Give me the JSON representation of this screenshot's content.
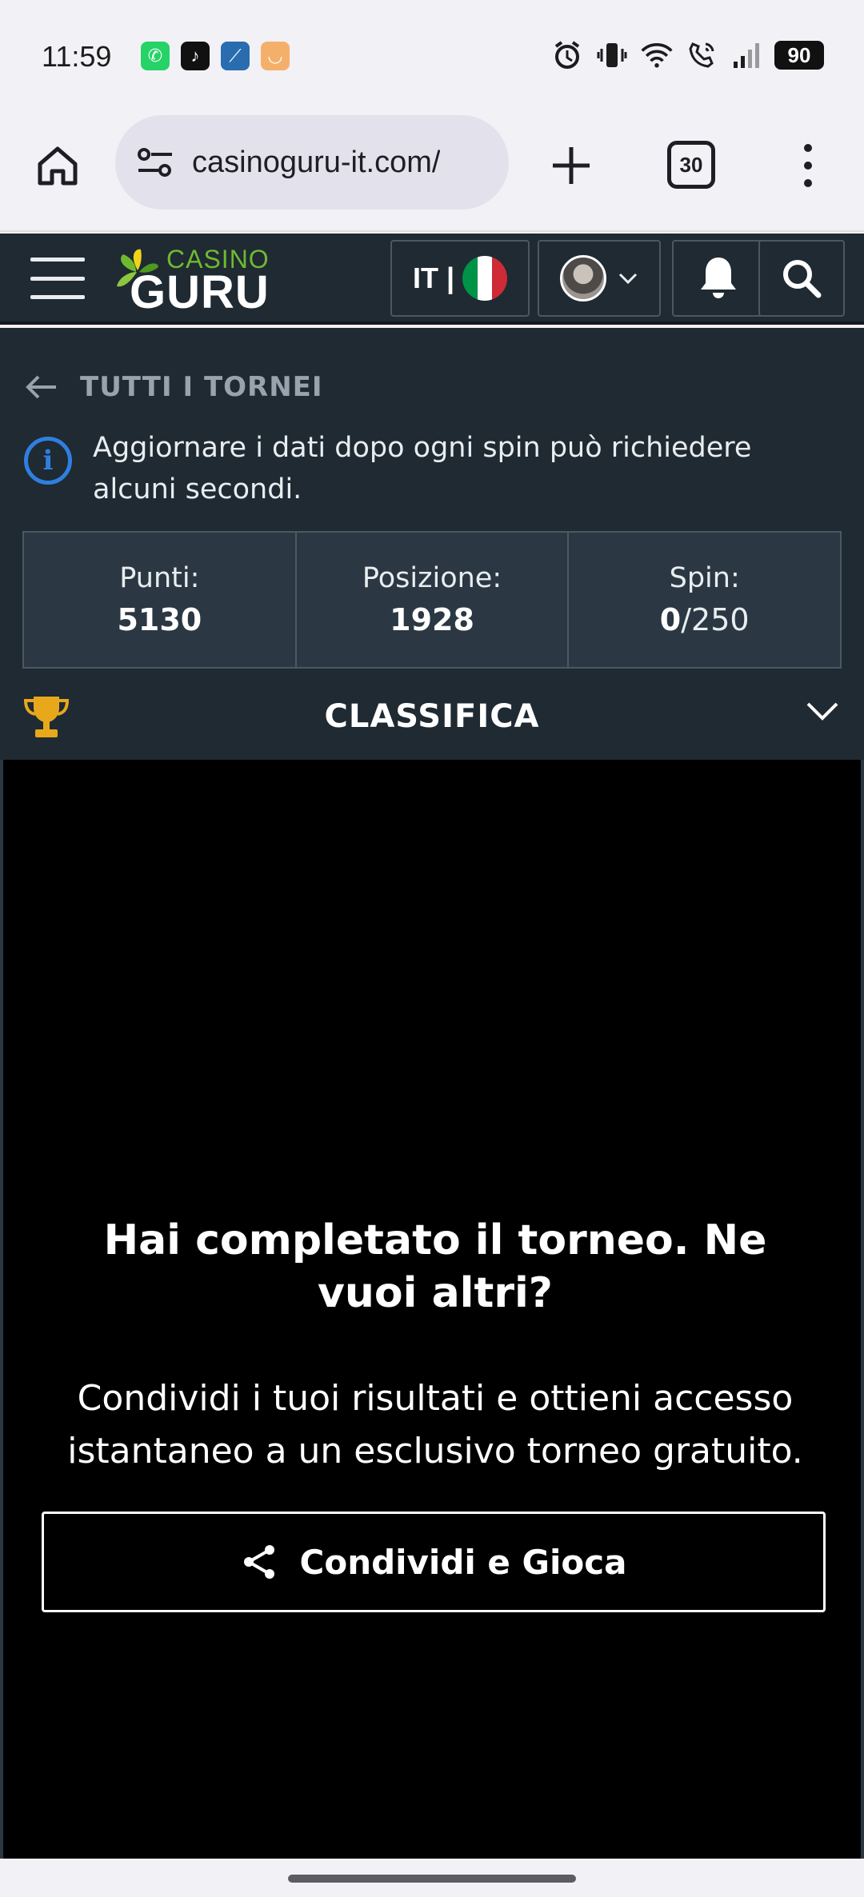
{
  "status_bar": {
    "time": "11:59",
    "battery": "90",
    "apps": [
      {
        "icon": "whatsapp-icon",
        "color": "#25d366",
        "glyph": "✆"
      },
      {
        "icon": "tiktok-icon",
        "color": "#111111",
        "glyph": "♪"
      },
      {
        "icon": "sportsapp-icon",
        "color": "#2a6cb0",
        "glyph": "⟋"
      },
      {
        "icon": "amazon-icon",
        "color": "#f4b06a",
        "glyph": "◡"
      }
    ]
  },
  "browser": {
    "url": "casinoguru-it.com/",
    "tab_count": "30"
  },
  "site_header": {
    "logo_top": "CASINO",
    "logo_main": "GURU",
    "language": "IT |",
    "flag_colors": [
      "#009246",
      "#ffffff",
      "#ce2b37"
    ]
  },
  "panel": {
    "back_label": "TUTTI I TORNEI",
    "info_text": "Aggiornare i dati dopo ogni spin può richiedere alcuni secondi.",
    "stats": {
      "points_label": "Punti:",
      "points_value": "5130",
      "position_label": "Posizione:",
      "position_value": "1928",
      "spins_label": "Spin:",
      "spins_used": "0",
      "spins_total": "250"
    },
    "leaderboard_label": "CLASSIFICA"
  },
  "game": {
    "title": "Hai completato il torneo. Ne vuoi altri?",
    "text": "Condividi i tuoi risultati e ottieni accesso istantaneo a un esclusivo torneo gratuito.",
    "share_label": "Condividi e Gioca"
  },
  "colors": {
    "header_bg": "#1f2a33",
    "info_blue": "#2f7fe0",
    "trophy_gold": "#e8a81c",
    "logo_green": "#6fb92f"
  }
}
